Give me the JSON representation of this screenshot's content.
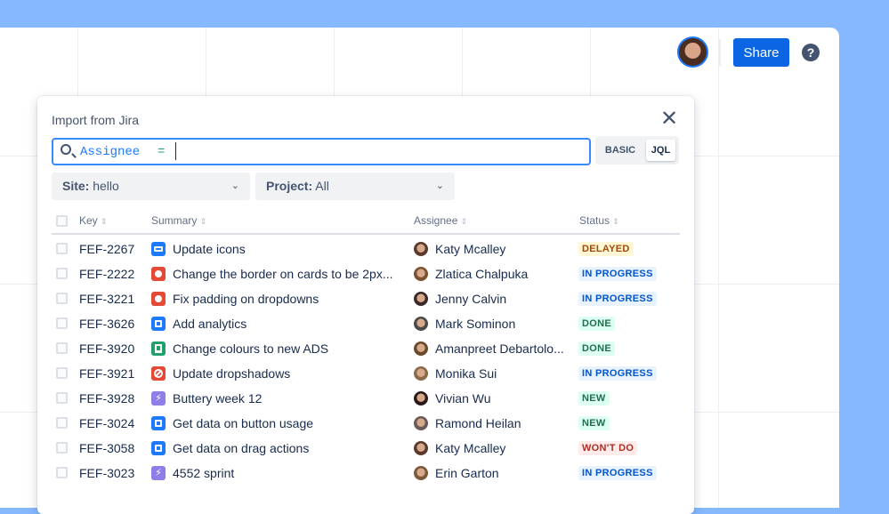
{
  "header": {
    "share_label": "Share",
    "help_label": "?"
  },
  "modal": {
    "title": "Import from Jira",
    "close_label": "✕",
    "search": {
      "field": "Assignee",
      "operator": "=",
      "value": ""
    },
    "mode": {
      "basic": "BASIC",
      "jql": "JQL",
      "selected": "JQL"
    },
    "filters": {
      "site_label": "Site:",
      "site_value": "hello",
      "project_label": "Project:",
      "project_value": "All"
    },
    "columns": {
      "key": "Key",
      "summary": "Summary",
      "assignee": "Assignee",
      "status": "Status",
      "sort": "⇕"
    },
    "rows": [
      {
        "key": "FEF-2267",
        "type": "task-wide",
        "summary": "Update icons",
        "assignee": "Katy Mcalley",
        "status": "DELAYED"
      },
      {
        "key": "FEF-2222",
        "type": "bug",
        "summary": "Change the border on cards to be 2px...",
        "assignee": "Zlatica Chalpuka",
        "status": "IN PROGRESS"
      },
      {
        "key": "FEF-3221",
        "type": "bug",
        "summary": "Fix padding on dropdowns",
        "assignee": "Jenny Calvin",
        "status": "IN PROGRESS"
      },
      {
        "key": "FEF-3626",
        "type": "task",
        "summary": "Add analytics",
        "assignee": "Mark Sominon",
        "status": "DONE"
      },
      {
        "key": "FEF-3920",
        "type": "story",
        "summary": "Change colours to new ADS",
        "assignee": "Amanpreet Debartolo...",
        "status": "DONE"
      },
      {
        "key": "FEF-3921",
        "type": "blocked",
        "summary": "Update dropshadows",
        "assignee": "Monika Sui",
        "status": "IN PROGRESS"
      },
      {
        "key": "FEF-3928",
        "type": "epic",
        "summary": "Buttery week 12",
        "assignee": "Vivian Wu",
        "status": "NEW"
      },
      {
        "key": "FEF-3024",
        "type": "task",
        "summary": "Get data on button usage",
        "assignee": "Ramond Heilan",
        "status": "NEW"
      },
      {
        "key": "FEF-3058",
        "type": "task",
        "summary": "Get data on drag actions",
        "assignee": "Katy Mcalley",
        "status": "WON'T DO"
      },
      {
        "key": "FEF-3023",
        "type": "epic",
        "summary": "4552 sprint",
        "assignee": "Erin Garton",
        "status": "IN PROGRESS"
      }
    ]
  },
  "colors": {
    "accent": "#0C66E4",
    "background": "#85B8FF"
  }
}
